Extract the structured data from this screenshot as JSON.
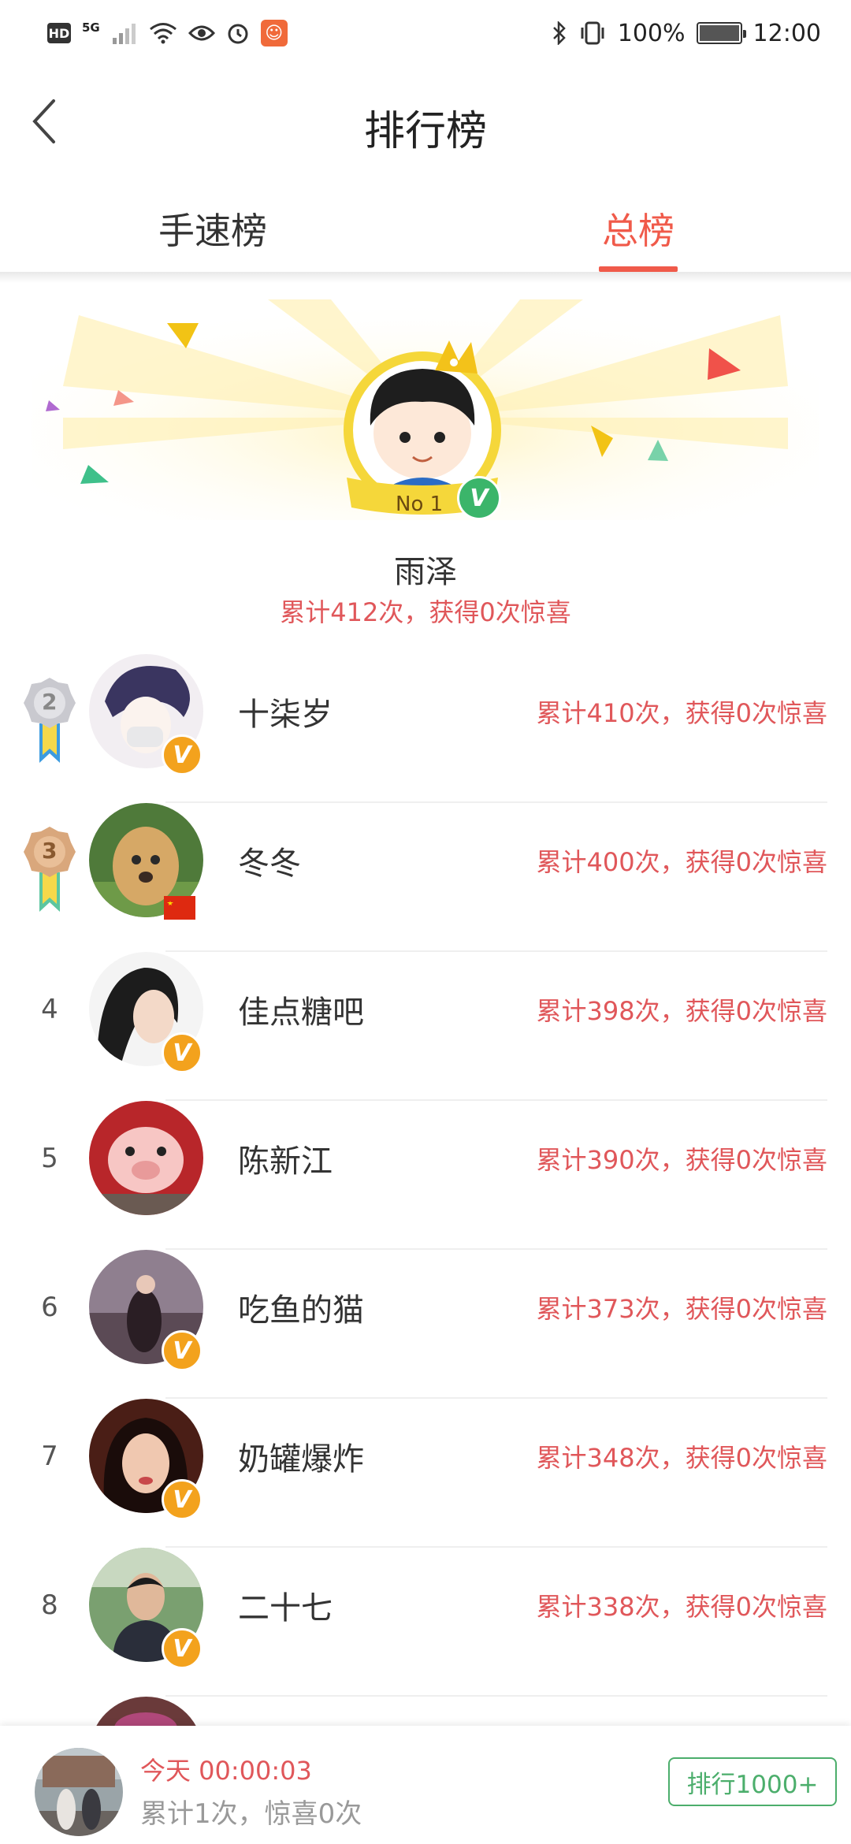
{
  "status_bar": {
    "hd": "HD",
    "network": "5G",
    "battery_percent": "100%",
    "battery_level": 1.0,
    "time": "12:00"
  },
  "header": {
    "title": "排行榜",
    "back_icon": "chevron-left-icon"
  },
  "tabs": [
    {
      "label": "手速榜",
      "active": false
    },
    {
      "label": "总榜",
      "active": true
    }
  ],
  "winner": {
    "badge_label": "No 1",
    "name": "雨泽",
    "stats": "累计412次，获得0次惊喜"
  },
  "rankings": [
    {
      "rank": "2",
      "medal": "silver",
      "name": "十柒岁",
      "stats": "累计410次，获得0次惊喜",
      "badge": "v"
    },
    {
      "rank": "3",
      "medal": "bronze",
      "name": "冬冬",
      "stats": "累计400次，获得0次惊喜",
      "badge": "flag"
    },
    {
      "rank": "4",
      "name": "佳点糖吧",
      "stats": "累计398次，获得0次惊喜",
      "badge": "v"
    },
    {
      "rank": "5",
      "name": "陈新江",
      "stats": "累计390次，获得0次惊喜",
      "badge": ""
    },
    {
      "rank": "6",
      "name": "吃鱼的猫",
      "stats": "累计373次，获得0次惊喜",
      "badge": "v"
    },
    {
      "rank": "7",
      "name": "奶罐爆炸",
      "stats": "累计348次，获得0次惊喜",
      "badge": "v"
    },
    {
      "rank": "8",
      "name": "二十七",
      "stats": "累计338次，获得0次惊喜",
      "badge": "v"
    }
  ],
  "me": {
    "time": "今天 00:00:03",
    "stats": "累计1次，惊喜0次",
    "rank_button": "排行1000+"
  },
  "colors": {
    "accent": "#f05a4a",
    "stats_red": "#e0575a",
    "badge_orange": "#f3a21d",
    "button_green": "#4cae6c"
  }
}
